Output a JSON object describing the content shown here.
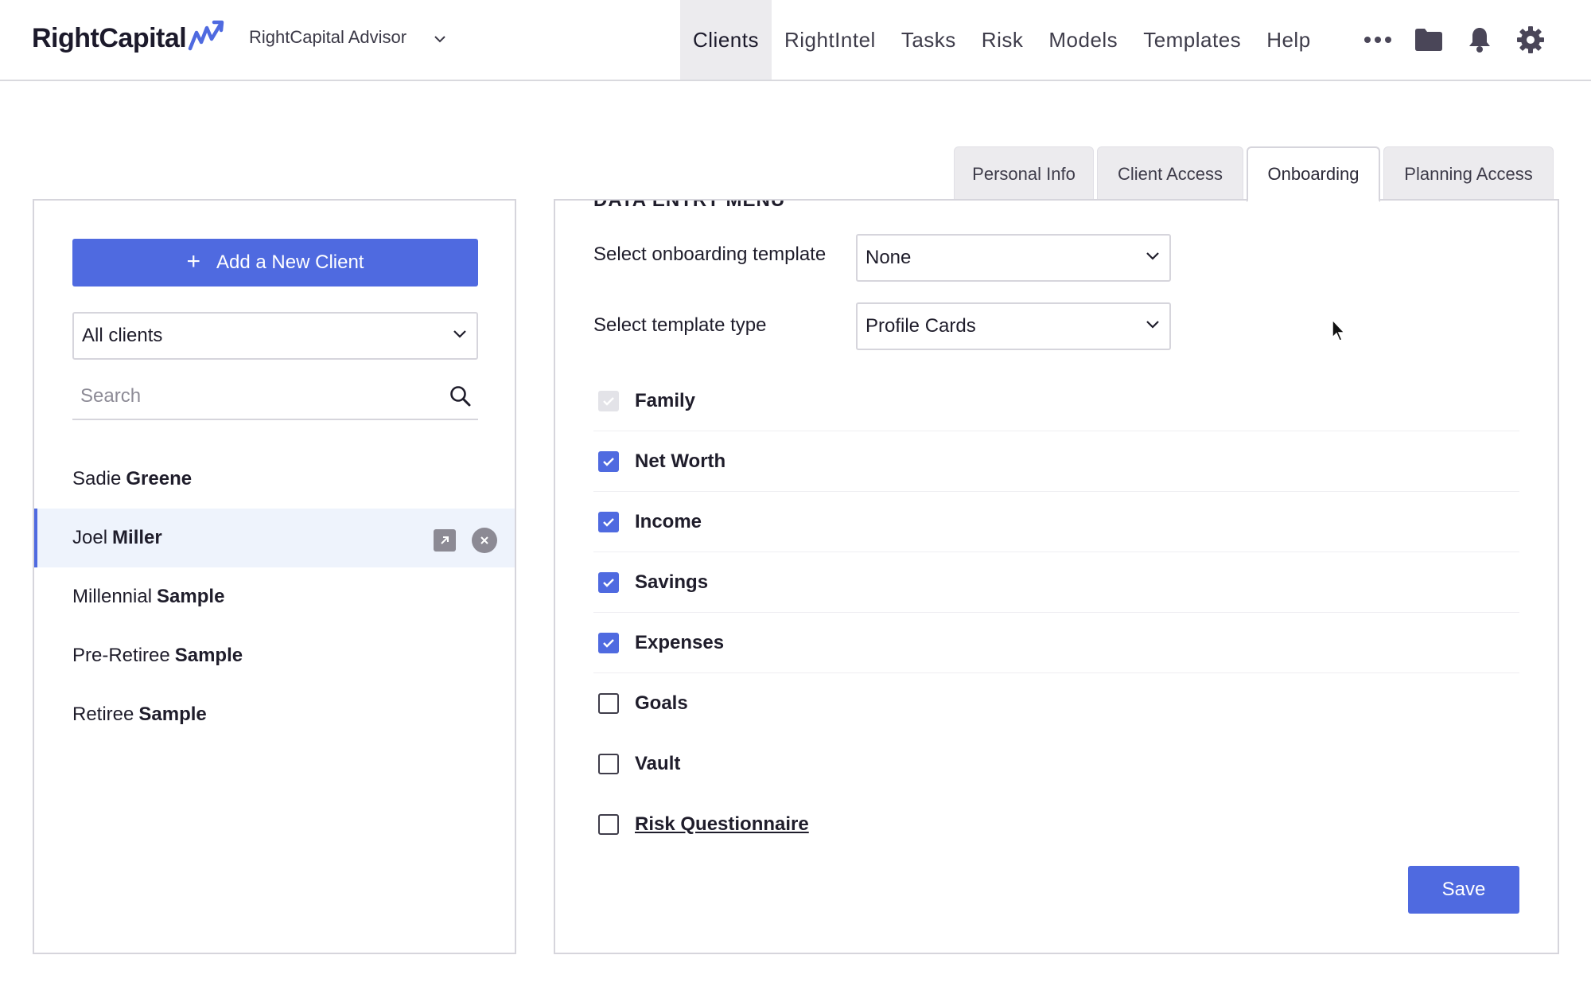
{
  "header": {
    "logo_text": "RightCapital",
    "advisor_name": "RightCapital Advisor",
    "nav": [
      {
        "label": "Clients",
        "active": true
      },
      {
        "label": "RightIntel"
      },
      {
        "label": "Tasks"
      },
      {
        "label": "Risk"
      },
      {
        "label": "Models"
      },
      {
        "label": "Templates"
      },
      {
        "label": "Help"
      }
    ],
    "icons": [
      "more-icon",
      "folder-icon",
      "bell-icon",
      "gear-icon"
    ]
  },
  "tabs": [
    "Personal Info",
    "Client Access",
    "Onboarding",
    "Planning Access"
  ],
  "active_tab": "Onboarding",
  "sidebar": {
    "add_client_label": "Add a New Client",
    "filter_value": "All clients",
    "search_placeholder": "Search",
    "clients": [
      {
        "first": "Sadie",
        "last": "Greene"
      },
      {
        "first": "Joel",
        "last": "Miller",
        "selected": true
      },
      {
        "first": "Millennial",
        "last": "Sample"
      },
      {
        "first": "Pre-Retiree",
        "last": "Sample"
      },
      {
        "first": "Retiree",
        "last": "Sample"
      }
    ]
  },
  "onboarding": {
    "section_heading_clipped": "DATA ENTRY MENU",
    "template_label": "Select onboarding template",
    "template_value": "None",
    "type_label": "Select template type",
    "type_value": "Profile Cards",
    "options": [
      {
        "label": "Family",
        "state": "disabled-checked"
      },
      {
        "label": "Net Worth",
        "state": "checked"
      },
      {
        "label": "Income",
        "state": "checked"
      },
      {
        "label": "Savings",
        "state": "checked"
      },
      {
        "label": "Expenses",
        "state": "checked"
      },
      {
        "label": "Goals",
        "state": "unchecked"
      },
      {
        "label": "Vault",
        "state": "unchecked"
      },
      {
        "label": "Risk Questionnaire",
        "state": "unchecked",
        "link": true
      }
    ],
    "save_label": "Save"
  },
  "colors": {
    "accent": "#4f6ae0",
    "selected_row_bg": "#eef3fc",
    "active_nav_bg": "#ecebee",
    "border": "#d6d5dc"
  }
}
